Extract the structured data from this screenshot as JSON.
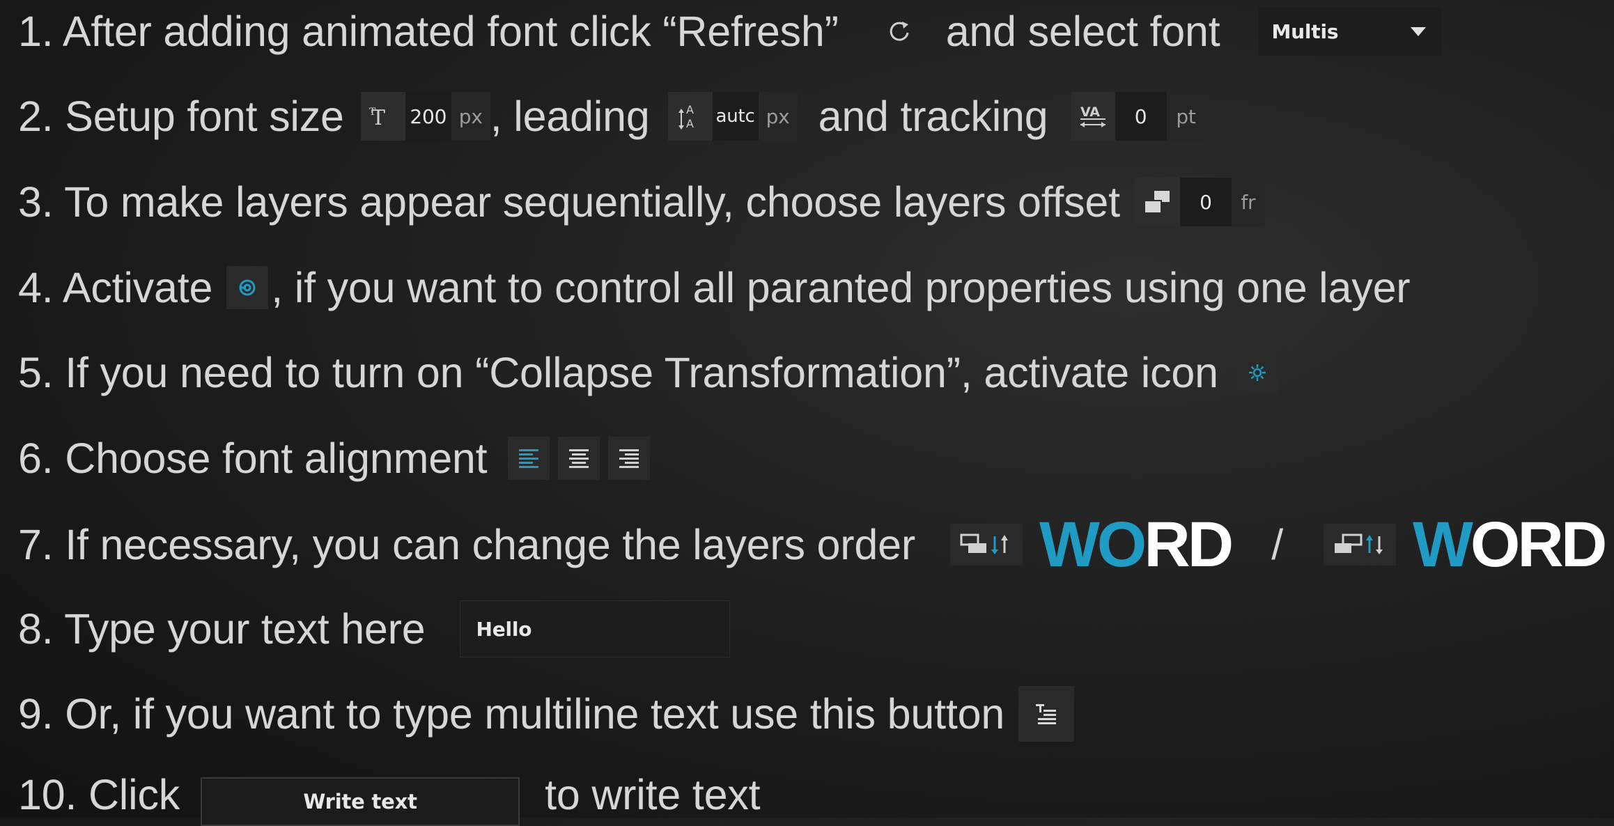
{
  "steps": {
    "s1": {
      "a": "1. After adding animated font click “Refresh”",
      "b": "and select font",
      "font_value": "Multis"
    },
    "s2": {
      "a": "2. Setup font size",
      "size_value": "200",
      "size_unit": "px",
      "b": ", leading",
      "leading_value": "autc",
      "leading_unit": "px",
      "c": "and tracking",
      "tracking_value": "0",
      "tracking_unit": "pt"
    },
    "s3": {
      "a": "3. To make layers appear sequentially, choose layers offset",
      "offset_value": "0",
      "offset_unit": "fr"
    },
    "s4": {
      "a": "4. Activate",
      "b": ", if you want to control all paranted properties using one layer"
    },
    "s5": {
      "a": "5. If you need to turn on “Collapse Transformation”, activate icon"
    },
    "s6": {
      "a": "6. Choose font alignment"
    },
    "s7": {
      "a": "7. If necessary, you can change the layers order",
      "word1_dark": "W",
      "word1_mid": "O",
      "word1_light": "RD",
      "sep": "/",
      "word2_dark": "W",
      "word2_light": "ORD"
    },
    "s8": {
      "a": "8. Type your text here",
      "text_value": "Hello"
    },
    "s9": {
      "a": "9. Or, if you want to type multiline text use this button"
    },
    "s10": {
      "a": "10. Click",
      "button_label": "Write text",
      "b": "to write text"
    }
  },
  "colors": {
    "accent": "#1f9bc4",
    "text": "#d6d6d6",
    "panel": "#262626",
    "word_white": "#ffffff"
  },
  "icons": [
    "refresh-icon",
    "font-size-icon",
    "leading-icon",
    "tracking-icon",
    "layers-offset-icon",
    "parent-control-icon",
    "collapse-transformation-icon",
    "align-left-icon",
    "align-center-icon",
    "align-right-icon",
    "layers-order-down-icon",
    "layers-order-up-icon",
    "multiline-text-icon"
  ]
}
